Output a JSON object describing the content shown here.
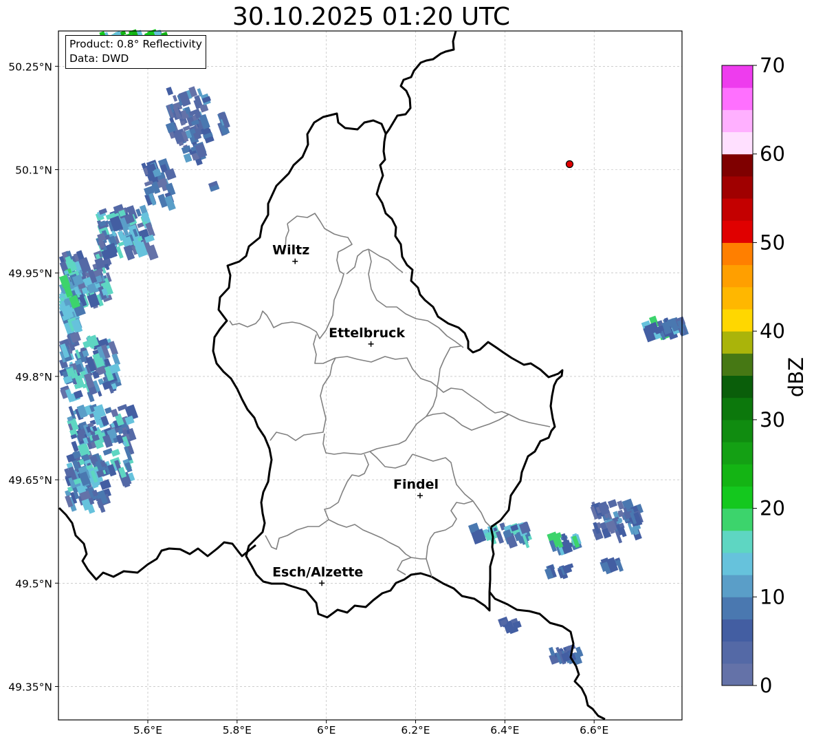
{
  "title": "30.10.2025 01:20 UTC",
  "info": {
    "product": "Product: 0.8° Reflectivity",
    "data_source": "Data: DWD"
  },
  "map": {
    "lat_ticks": [
      "50.25°N",
      "50.1°N",
      "49.95°N",
      "49.8°N",
      "49.65°N",
      "49.5°N",
      "49.35°N"
    ],
    "lon_ticks": [
      "5.6°E",
      "5.8°E",
      "6°E",
      "6.2°E",
      "6.4°E",
      "6.6°E"
    ],
    "cities": [
      {
        "name": "Wiltz",
        "lon": 5.93,
        "lat": 49.967
      },
      {
        "name": "Ettelbruck",
        "lon": 6.1,
        "lat": 49.847
      },
      {
        "name": "Findel",
        "lon": 6.21,
        "lat": 49.627
      },
      {
        "name": "Esch/Alzette",
        "lon": 5.99,
        "lat": 49.5
      }
    ],
    "marker_point": {
      "lon": 6.545,
      "lat": 50.108,
      "color": "#e00000"
    },
    "border_color": "#000000",
    "canton_color": "#808080"
  },
  "colorbar": {
    "label": "dBZ",
    "min": 0,
    "max": 70,
    "tick_labels": [
      "0",
      "10",
      "20",
      "30",
      "40",
      "50",
      "60",
      "70"
    ],
    "colors": [
      "#6472a8",
      "#5469a6",
      "#435ea2",
      "#4a78b0",
      "#5a9ec8",
      "#66c2dc",
      "#5ed6c2",
      "#3cd46c",
      "#14c81e",
      "#14b414",
      "#14a014",
      "#108c10",
      "#0c780c",
      "#0a5e0a",
      "#467814",
      "#aab40a",
      "#ffd700",
      "#ffb700",
      "#ff9f00",
      "#ff7f00",
      "#e00000",
      "#c40000",
      "#a00000",
      "#7f0000",
      "#ffe0ff",
      "#ffb0ff",
      "#ff70ff",
      "#ee3cee"
    ]
  }
}
